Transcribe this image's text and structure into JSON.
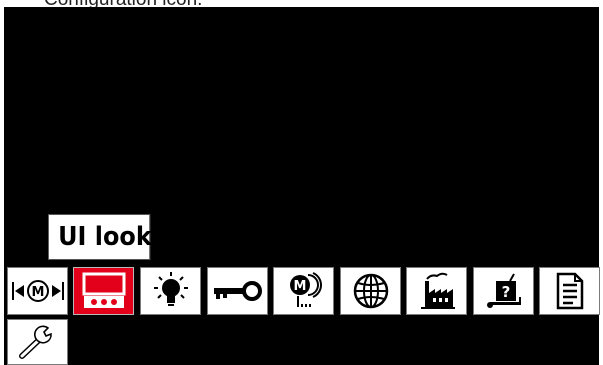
{
  "caption": {
    "text": "Configuration icon."
  },
  "tooltip": {
    "label": "UI look"
  },
  "tiles": [
    {
      "name": "memory-transfer",
      "icon": "memory-transfer-icon",
      "glyph": "M"
    },
    {
      "name": "ui-look",
      "icon": "display-icon",
      "selected": true
    },
    {
      "name": "brightness",
      "icon": "light-bulb-icon"
    },
    {
      "name": "access-control",
      "icon": "key-icon"
    },
    {
      "name": "memory-settings",
      "icon": "memory-m-icon",
      "glyph": "M"
    },
    {
      "name": "language",
      "icon": "globe-icon"
    },
    {
      "name": "factory-reset",
      "icon": "factory-icon"
    },
    {
      "name": "help",
      "icon": "question-cart-icon",
      "glyph": "?"
    },
    {
      "name": "info",
      "icon": "document-icon"
    },
    {
      "name": "service",
      "icon": "wrench-icon"
    }
  ],
  "colors": {
    "screen": "#000000",
    "tile": "#ffffff",
    "selected": "#e2001a",
    "icon": "#000000"
  }
}
